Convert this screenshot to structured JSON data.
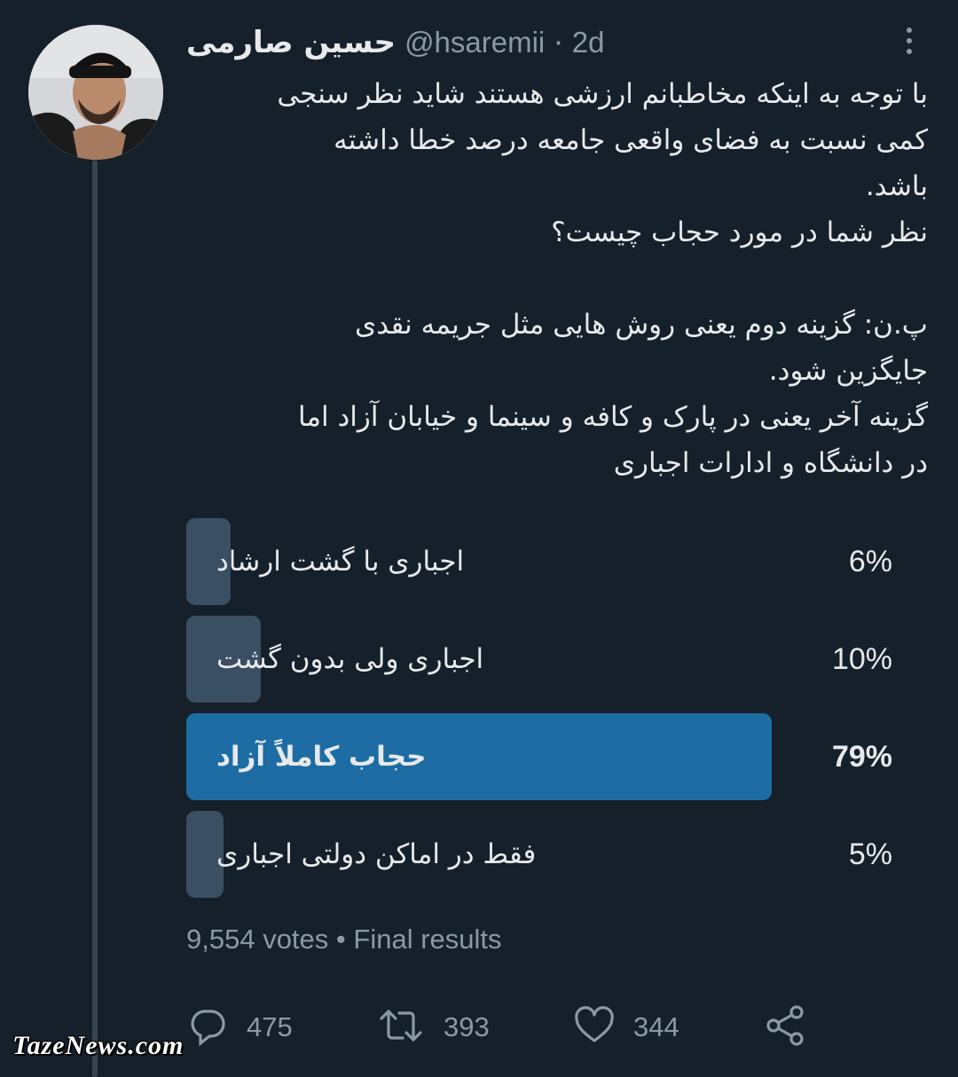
{
  "tweet": {
    "author_name": "حسین صارمی",
    "handle": "@hsaremii",
    "separator": "·",
    "time": "2d",
    "text_lines": [
      "با توجه به اینکه مخاطبانم ارزشی هستند شاید نظر سنجی",
      "کمی نسبت به فضای واقعی جامعه درصد خطا داشته",
      "باشد.",
      "نظر شما در مورد حجاب چیست؟",
      "",
      "پ.ن: گزینه دوم یعنی روش هایی مثل جریمه نقدی",
      "جایگزین شود.",
      "گزینه آخر یعنی در پارک و کافه و سینما و خیابان آزاد اما",
      "در دانشگاه و ادارات اجباری"
    ]
  },
  "poll": {
    "options": [
      {
        "label": "اجباری با گشت ارشاد",
        "percent_text": "6%",
        "share": 0.06,
        "winner": false
      },
      {
        "label": "اجباری ولی بدون گشت",
        "percent_text": "10%",
        "share": 0.1,
        "winner": false
      },
      {
        "label": "حجاب کاملاً آزاد",
        "percent_text": "79%",
        "share": 0.79,
        "winner": true
      },
      {
        "label": "فقط در اماکن دولتی اجباری",
        "percent_text": "5%",
        "share": 0.05,
        "winner": false
      }
    ],
    "votes_text": "9,554 votes",
    "meta_separator": "•",
    "status_text": "Final results"
  },
  "actions": {
    "reply": {
      "icon": "reply-icon",
      "count": "475"
    },
    "retweet": {
      "icon": "retweet-icon",
      "count": "393"
    },
    "like": {
      "icon": "heart-icon",
      "count": "344"
    },
    "share": {
      "icon": "share-icon"
    }
  },
  "watermark": "TazeNews.com",
  "colors": {
    "background": "#15202b",
    "winner_bar": "#1d6da4",
    "bar": "#3a4f61",
    "secondary_text": "#8b98a5",
    "primary_text": "#e7e9ea"
  }
}
